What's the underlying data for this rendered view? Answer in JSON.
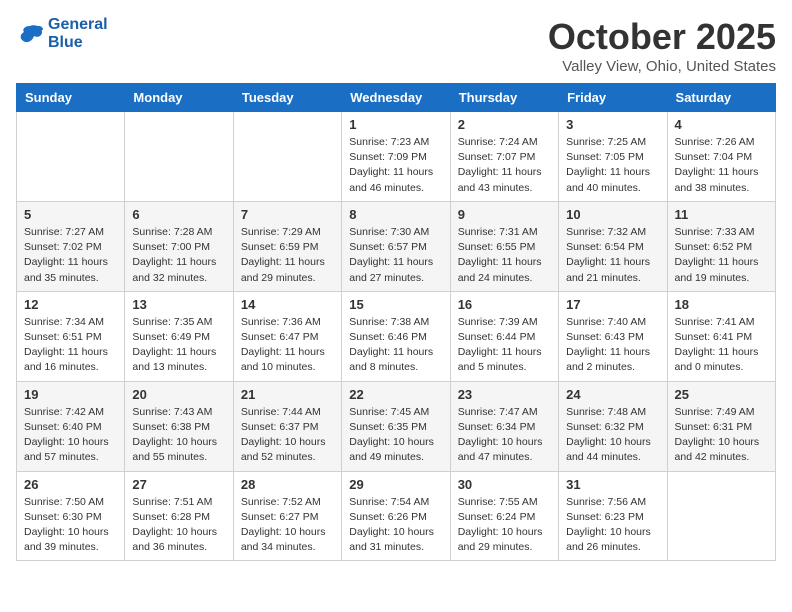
{
  "header": {
    "logo_line1": "General",
    "logo_line2": "Blue",
    "title": "October 2025",
    "subtitle": "Valley View, Ohio, United States"
  },
  "weekdays": [
    "Sunday",
    "Monday",
    "Tuesday",
    "Wednesday",
    "Thursday",
    "Friday",
    "Saturday"
  ],
  "weeks": [
    [
      {
        "day": "",
        "sunrise": "",
        "sunset": "",
        "daylight": ""
      },
      {
        "day": "",
        "sunrise": "",
        "sunset": "",
        "daylight": ""
      },
      {
        "day": "",
        "sunrise": "",
        "sunset": "",
        "daylight": ""
      },
      {
        "day": "1",
        "sunrise": "Sunrise: 7:23 AM",
        "sunset": "Sunset: 7:09 PM",
        "daylight": "Daylight: 11 hours and 46 minutes."
      },
      {
        "day": "2",
        "sunrise": "Sunrise: 7:24 AM",
        "sunset": "Sunset: 7:07 PM",
        "daylight": "Daylight: 11 hours and 43 minutes."
      },
      {
        "day": "3",
        "sunrise": "Sunrise: 7:25 AM",
        "sunset": "Sunset: 7:05 PM",
        "daylight": "Daylight: 11 hours and 40 minutes."
      },
      {
        "day": "4",
        "sunrise": "Sunrise: 7:26 AM",
        "sunset": "Sunset: 7:04 PM",
        "daylight": "Daylight: 11 hours and 38 minutes."
      }
    ],
    [
      {
        "day": "5",
        "sunrise": "Sunrise: 7:27 AM",
        "sunset": "Sunset: 7:02 PM",
        "daylight": "Daylight: 11 hours and 35 minutes."
      },
      {
        "day": "6",
        "sunrise": "Sunrise: 7:28 AM",
        "sunset": "Sunset: 7:00 PM",
        "daylight": "Daylight: 11 hours and 32 minutes."
      },
      {
        "day": "7",
        "sunrise": "Sunrise: 7:29 AM",
        "sunset": "Sunset: 6:59 PM",
        "daylight": "Daylight: 11 hours and 29 minutes."
      },
      {
        "day": "8",
        "sunrise": "Sunrise: 7:30 AM",
        "sunset": "Sunset: 6:57 PM",
        "daylight": "Daylight: 11 hours and 27 minutes."
      },
      {
        "day": "9",
        "sunrise": "Sunrise: 7:31 AM",
        "sunset": "Sunset: 6:55 PM",
        "daylight": "Daylight: 11 hours and 24 minutes."
      },
      {
        "day": "10",
        "sunrise": "Sunrise: 7:32 AM",
        "sunset": "Sunset: 6:54 PM",
        "daylight": "Daylight: 11 hours and 21 minutes."
      },
      {
        "day": "11",
        "sunrise": "Sunrise: 7:33 AM",
        "sunset": "Sunset: 6:52 PM",
        "daylight": "Daylight: 11 hours and 19 minutes."
      }
    ],
    [
      {
        "day": "12",
        "sunrise": "Sunrise: 7:34 AM",
        "sunset": "Sunset: 6:51 PM",
        "daylight": "Daylight: 11 hours and 16 minutes."
      },
      {
        "day": "13",
        "sunrise": "Sunrise: 7:35 AM",
        "sunset": "Sunset: 6:49 PM",
        "daylight": "Daylight: 11 hours and 13 minutes."
      },
      {
        "day": "14",
        "sunrise": "Sunrise: 7:36 AM",
        "sunset": "Sunset: 6:47 PM",
        "daylight": "Daylight: 11 hours and 10 minutes."
      },
      {
        "day": "15",
        "sunrise": "Sunrise: 7:38 AM",
        "sunset": "Sunset: 6:46 PM",
        "daylight": "Daylight: 11 hours and 8 minutes."
      },
      {
        "day": "16",
        "sunrise": "Sunrise: 7:39 AM",
        "sunset": "Sunset: 6:44 PM",
        "daylight": "Daylight: 11 hours and 5 minutes."
      },
      {
        "day": "17",
        "sunrise": "Sunrise: 7:40 AM",
        "sunset": "Sunset: 6:43 PM",
        "daylight": "Daylight: 11 hours and 2 minutes."
      },
      {
        "day": "18",
        "sunrise": "Sunrise: 7:41 AM",
        "sunset": "Sunset: 6:41 PM",
        "daylight": "Daylight: 11 hours and 0 minutes."
      }
    ],
    [
      {
        "day": "19",
        "sunrise": "Sunrise: 7:42 AM",
        "sunset": "Sunset: 6:40 PM",
        "daylight": "Daylight: 10 hours and 57 minutes."
      },
      {
        "day": "20",
        "sunrise": "Sunrise: 7:43 AM",
        "sunset": "Sunset: 6:38 PM",
        "daylight": "Daylight: 10 hours and 55 minutes."
      },
      {
        "day": "21",
        "sunrise": "Sunrise: 7:44 AM",
        "sunset": "Sunset: 6:37 PM",
        "daylight": "Daylight: 10 hours and 52 minutes."
      },
      {
        "day": "22",
        "sunrise": "Sunrise: 7:45 AM",
        "sunset": "Sunset: 6:35 PM",
        "daylight": "Daylight: 10 hours and 49 minutes."
      },
      {
        "day": "23",
        "sunrise": "Sunrise: 7:47 AM",
        "sunset": "Sunset: 6:34 PM",
        "daylight": "Daylight: 10 hours and 47 minutes."
      },
      {
        "day": "24",
        "sunrise": "Sunrise: 7:48 AM",
        "sunset": "Sunset: 6:32 PM",
        "daylight": "Daylight: 10 hours and 44 minutes."
      },
      {
        "day": "25",
        "sunrise": "Sunrise: 7:49 AM",
        "sunset": "Sunset: 6:31 PM",
        "daylight": "Daylight: 10 hours and 42 minutes."
      }
    ],
    [
      {
        "day": "26",
        "sunrise": "Sunrise: 7:50 AM",
        "sunset": "Sunset: 6:30 PM",
        "daylight": "Daylight: 10 hours and 39 minutes."
      },
      {
        "day": "27",
        "sunrise": "Sunrise: 7:51 AM",
        "sunset": "Sunset: 6:28 PM",
        "daylight": "Daylight: 10 hours and 36 minutes."
      },
      {
        "day": "28",
        "sunrise": "Sunrise: 7:52 AM",
        "sunset": "Sunset: 6:27 PM",
        "daylight": "Daylight: 10 hours and 34 minutes."
      },
      {
        "day": "29",
        "sunrise": "Sunrise: 7:54 AM",
        "sunset": "Sunset: 6:26 PM",
        "daylight": "Daylight: 10 hours and 31 minutes."
      },
      {
        "day": "30",
        "sunrise": "Sunrise: 7:55 AM",
        "sunset": "Sunset: 6:24 PM",
        "daylight": "Daylight: 10 hours and 29 minutes."
      },
      {
        "day": "31",
        "sunrise": "Sunrise: 7:56 AM",
        "sunset": "Sunset: 6:23 PM",
        "daylight": "Daylight: 10 hours and 26 minutes."
      },
      {
        "day": "",
        "sunrise": "",
        "sunset": "",
        "daylight": ""
      }
    ]
  ]
}
